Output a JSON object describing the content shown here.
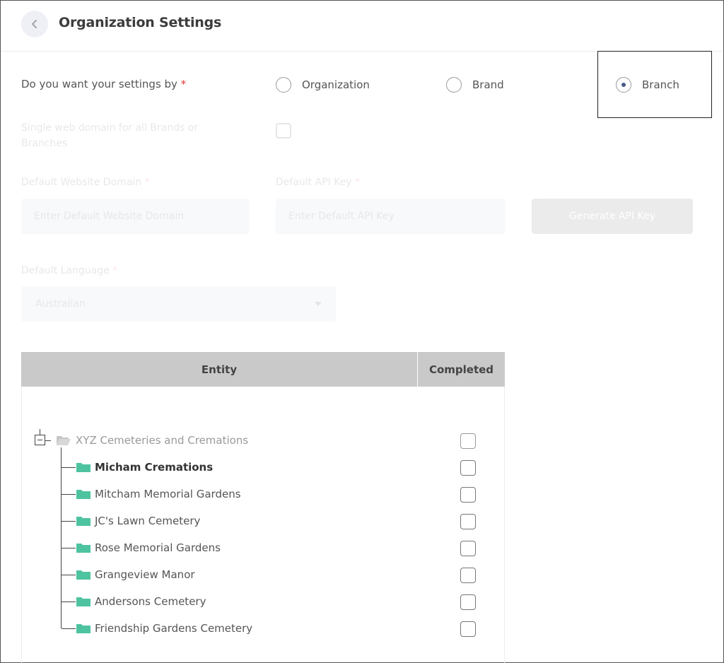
{
  "header": {
    "title": "Organization Settings",
    "back_icon": "chevron-left-icon"
  },
  "settings_by": {
    "label": "Do you want your settings by",
    "required_mark": "*",
    "options": [
      {
        "label": "Organization",
        "checked": false
      },
      {
        "label": "Brand",
        "checked": false
      },
      {
        "label": "Branch",
        "checked": true
      }
    ]
  },
  "single_domain": {
    "label": "Single web domain for all Brands or Branches",
    "checked": false
  },
  "default_domain": {
    "label": "Default Website Domain",
    "required_mark": "*",
    "placeholder": "Enter Default Website Domain"
  },
  "default_api_key": {
    "label": "Default API Key",
    "required_mark": "*",
    "placeholder": "Enter Default API Key"
  },
  "generate_button": {
    "label": "Generate API Key"
  },
  "default_language": {
    "label": "Default Language",
    "required_mark": "*",
    "value": "Australian"
  },
  "table": {
    "headers": {
      "entity": "Entity",
      "completed": "Completed"
    },
    "root": {
      "label": "XYZ Cemeteries and Cremations",
      "completed": false
    },
    "children": [
      {
        "label": "Micham Cremations",
        "bold": true,
        "completed": false
      },
      {
        "label": "Mitcham Memorial Gardens",
        "bold": false,
        "completed": false
      },
      {
        "label": "JC's Lawn Cemetery",
        "bold": false,
        "completed": false
      },
      {
        "label": "Rose Memorial Gardens",
        "bold": false,
        "completed": false
      },
      {
        "label": "Grangeview Manor",
        "bold": false,
        "completed": false
      },
      {
        "label": "Andersons Cemetery",
        "bold": false,
        "completed": false
      },
      {
        "label": "Friendship Gardens Cemetery",
        "bold": false,
        "completed": false
      }
    ]
  },
  "colors": {
    "accent": "#4a5a88",
    "folder_green": "#4ec3a0",
    "required": "#e53935",
    "table_header": "#c9c9c9"
  }
}
